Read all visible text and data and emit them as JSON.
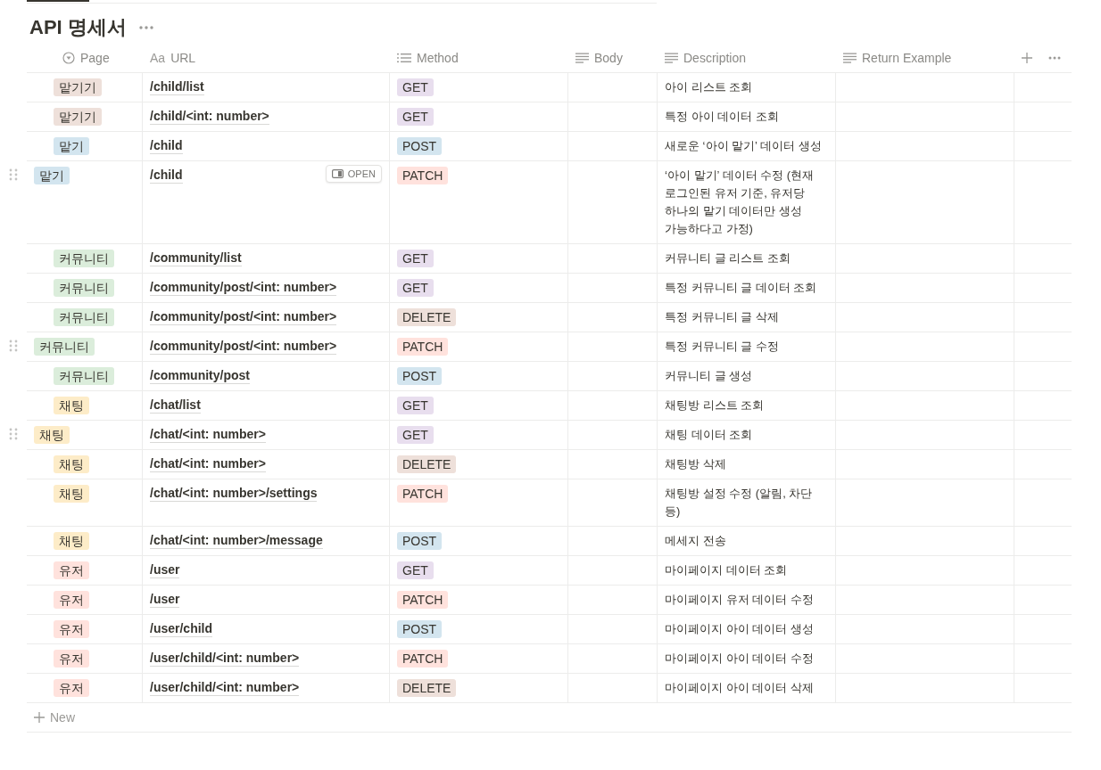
{
  "title": "API 명세서",
  "columns": [
    {
      "label": "Page",
      "kind": "select"
    },
    {
      "label": "URL",
      "kind": "title",
      "prefix": "Aa"
    },
    {
      "label": "Method",
      "kind": "multi"
    },
    {
      "label": "Body",
      "kind": "text"
    },
    {
      "label": "Description",
      "kind": "text"
    },
    {
      "label": "Return Example",
      "kind": "text"
    }
  ],
  "rows": [
    {
      "page": {
        "label": "맡기기",
        "color": "#eee0da"
      },
      "url": "/child/list",
      "method": {
        "label": "GET",
        "color": "#e8deee"
      },
      "description": "아이 리스트 조회",
      "handle": false
    },
    {
      "page": {
        "label": "맡기기",
        "color": "#eee0da"
      },
      "url": "/child/<int: number>",
      "method": {
        "label": "GET",
        "color": "#e8deee"
      },
      "description": "특정 아이 데이터 조회",
      "handle": false
    },
    {
      "page": {
        "label": "맡기",
        "color": "#d3e5ef"
      },
      "url": "/child",
      "method": {
        "label": "POST",
        "color": "#d3e5ef"
      },
      "description": "새로운 ‘아이 맡기’ 데이터 생성",
      "handle": false
    },
    {
      "page": {
        "label": "맡기",
        "color": "#d3e5ef"
      },
      "url": "/child",
      "open_button": "OPEN",
      "method": {
        "label": "PATCH",
        "color": "#ffe2dd"
      },
      "description": "‘아이 맡기’ 데이터 수정 (현재 로그인된 유저 기준, 유저당 하나의 맡기 데이터만 생성 가능하다고 가정)",
      "handle": true
    },
    {
      "page": {
        "label": "커뮤니티",
        "color": "#dbeddb"
      },
      "url": "/community/list",
      "method": {
        "label": "GET",
        "color": "#e8deee"
      },
      "description": "커뮤니티 글 리스트 조회",
      "handle": false
    },
    {
      "page": {
        "label": "커뮤니티",
        "color": "#dbeddb"
      },
      "url": "/community/post/<int: number>",
      "method": {
        "label": "GET",
        "color": "#e8deee"
      },
      "description": "특정 커뮤니티 글 데이터 조회",
      "handle": false
    },
    {
      "page": {
        "label": "커뮤니티",
        "color": "#dbeddb"
      },
      "url": "/community/post/<int: number>",
      "method": {
        "label": "DELETE",
        "color": "#eee0da"
      },
      "description": "특정 커뮤니티 글 삭제",
      "handle": false
    },
    {
      "page": {
        "label": "커뮤니티",
        "color": "#dbeddb"
      },
      "url": "/community/post/<int: number>",
      "method": {
        "label": "PATCH",
        "color": "#ffe2dd"
      },
      "description": "특정 커뮤니티 글 수정",
      "handle": true
    },
    {
      "page": {
        "label": "커뮤니티",
        "color": "#dbeddb"
      },
      "url": "/community/post",
      "method": {
        "label": "POST",
        "color": "#d3e5ef"
      },
      "description": "커뮤니티 글 생성",
      "handle": false
    },
    {
      "page": {
        "label": "채팅",
        "color": "#fdecc8"
      },
      "url": "/chat/list",
      "method": {
        "label": "GET",
        "color": "#e8deee"
      },
      "description": "채팅방 리스트 조회",
      "handle": false
    },
    {
      "page": {
        "label": "채팅",
        "color": "#fdecc8"
      },
      "url": "/chat/<int: number>",
      "method": {
        "label": "GET",
        "color": "#e8deee"
      },
      "description": "채팅 데이터 조회",
      "handle": true
    },
    {
      "page": {
        "label": "채팅",
        "color": "#fdecc8"
      },
      "url": "/chat/<int: number>",
      "method": {
        "label": "DELETE",
        "color": "#eee0da"
      },
      "description": "채팅방 삭제",
      "handle": false
    },
    {
      "page": {
        "label": "채팅",
        "color": "#fdecc8"
      },
      "url": "/chat/<int: number>/settings",
      "method": {
        "label": "PATCH",
        "color": "#ffe2dd"
      },
      "description": "채팅방 설정 수정 (알림, 차단 등)",
      "handle": false
    },
    {
      "page": {
        "label": "채팅",
        "color": "#fdecc8"
      },
      "url": "/chat/<int: number>/message",
      "method": {
        "label": "POST",
        "color": "#d3e5ef"
      },
      "description": "메세지 전송",
      "handle": false
    },
    {
      "page": {
        "label": "유저",
        "color": "#ffe2dd"
      },
      "url": "/user",
      "method": {
        "label": "GET",
        "color": "#e8deee"
      },
      "description": "마이페이지 데이터 조회",
      "handle": false
    },
    {
      "page": {
        "label": "유저",
        "color": "#ffe2dd"
      },
      "url": "/user",
      "method": {
        "label": "PATCH",
        "color": "#ffe2dd"
      },
      "description": "마이페이지 유저 데이터 수정",
      "handle": false
    },
    {
      "page": {
        "label": "유저",
        "color": "#ffe2dd"
      },
      "url": "/user/child",
      "method": {
        "label": "POST",
        "color": "#d3e5ef"
      },
      "description": "마이페이지 아이 데이터 생성",
      "handle": false
    },
    {
      "page": {
        "label": "유저",
        "color": "#ffe2dd"
      },
      "url": "/user/child/<int: number>",
      "method": {
        "label": "PATCH",
        "color": "#ffe2dd"
      },
      "description": "마이페이지 아이 데이터 수정",
      "handle": false
    },
    {
      "page": {
        "label": "유저",
        "color": "#ffe2dd"
      },
      "url": "/user/child/<int: number>",
      "method": {
        "label": "DELETE",
        "color": "#eee0da"
      },
      "description": "마이페이지 아이 데이터 삭제",
      "handle": false
    }
  ],
  "new_row": "New"
}
